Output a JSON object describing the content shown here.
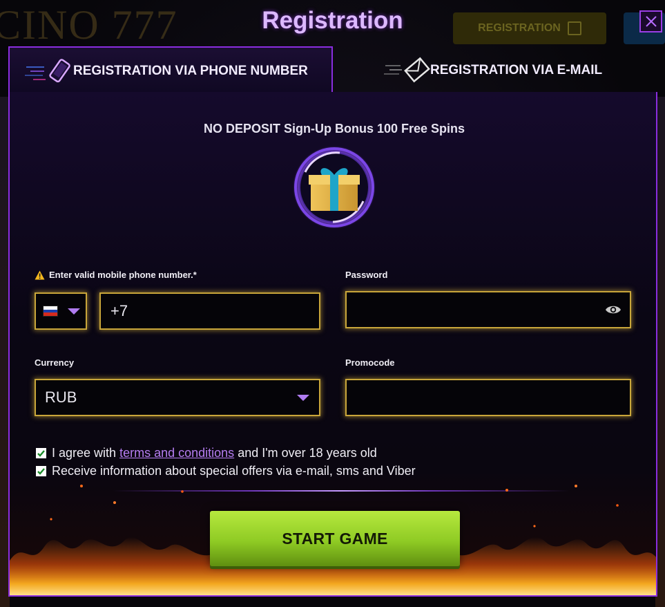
{
  "background": {
    "logo_text": "CINO 777",
    "header_register_label": "REGISTRATION"
  },
  "modal": {
    "title": "Registration",
    "close_icon": "close-x-icon"
  },
  "tabs": [
    {
      "label": "REGISTRATION VIA PHONE NUMBER",
      "icon": "phone-icon",
      "active": true
    },
    {
      "label": "REGISTRATION VIA E-MAIL",
      "icon": "envelope-icon",
      "active": false
    }
  ],
  "bonus": {
    "text": "NO DEPOSIT Sign-Up Bonus 100 Free Spins",
    "icon": "gift-icon"
  },
  "form": {
    "phone_label": "Enter valid mobile phone number.*",
    "phone_warning_icon": "warning-icon",
    "country_flag": "russia-flag-icon",
    "phone_value": "+7",
    "password_label": "Password",
    "password_value": "",
    "currency_label": "Currency",
    "currency_value": "RUB",
    "promocode_label": "Promocode",
    "promocode_value": ""
  },
  "checkboxes": {
    "agree_prefix": "I agree with",
    "agree_link": "terms and conditions",
    "agree_suffix": "and I'm over 18 years old",
    "agree_checked": true,
    "offers_label": "Receive information about special offers via e-mail, sms and Viber",
    "offers_checked": true
  },
  "submit": {
    "label": "START GAME"
  },
  "colors": {
    "accent_purple": "#8a2de0",
    "field_border_gold": "#c9a63a",
    "title_lilac": "#dcb8ff",
    "button_green": "#8fcb24",
    "link_purple": "#b67ef2",
    "checkbox_green": "#1a8c2a"
  }
}
